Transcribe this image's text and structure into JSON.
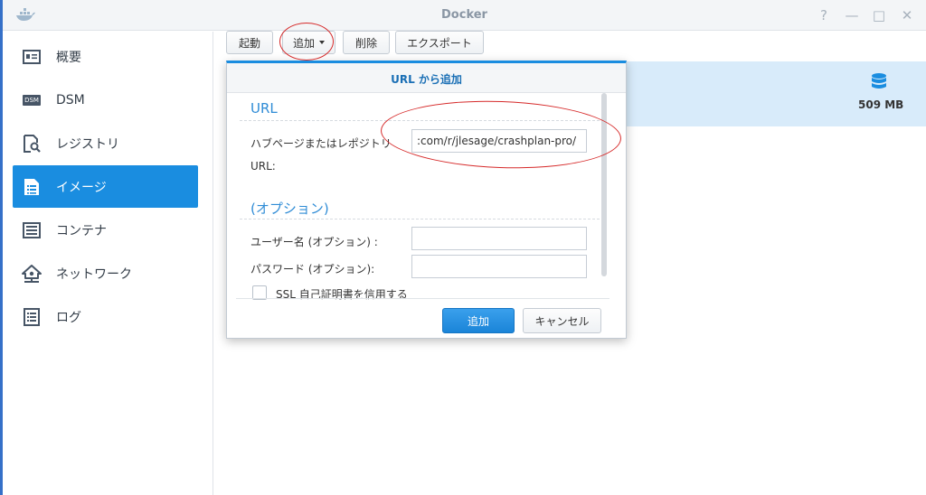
{
  "window": {
    "title": "Docker",
    "controls": [
      "?",
      "—",
      "□",
      "✕"
    ]
  },
  "sidebar": {
    "items": [
      {
        "label": "概要",
        "icon": "overview-icon",
        "active": false
      },
      {
        "label": "DSM",
        "icon": "dsm-icon",
        "active": false
      },
      {
        "label": "レジストリ",
        "icon": "registry-icon",
        "active": false
      },
      {
        "label": "イメージ",
        "icon": "image-icon",
        "active": true
      },
      {
        "label": "コンテナ",
        "icon": "container-icon",
        "active": false
      },
      {
        "label": "ネットワーク",
        "icon": "network-icon",
        "active": false
      },
      {
        "label": "ログ",
        "icon": "log-icon",
        "active": false
      }
    ],
    "dsm_badge": "DSM"
  },
  "toolbar": {
    "launch_label": "起動",
    "add_label": "追加",
    "delete_label": "削除",
    "export_label": "エクスポート"
  },
  "image_row": {
    "size": "509 MB",
    "icon": "database-icon"
  },
  "dialog": {
    "title": "URL から追加",
    "url_section": "URL",
    "repo_label_line1": "ハブページまたはレポジトリ",
    "repo_label_line2": "URL:",
    "repo_value": ":com/r/jlesage/crashplan-pro/",
    "options_section": "(オプション)",
    "username_label": "ユーザー名 (オプション) :",
    "username_value": "",
    "password_label": "パスワード (オプション):",
    "password_value": "",
    "ssl_label": "SSL 自己証明書を信用する",
    "ok_label": "追加",
    "cancel_label": "キャンセル"
  },
  "colors": {
    "accent": "#1a8de0",
    "annotation": "#d62a2a",
    "row_highlight": "#d8ebfa"
  }
}
